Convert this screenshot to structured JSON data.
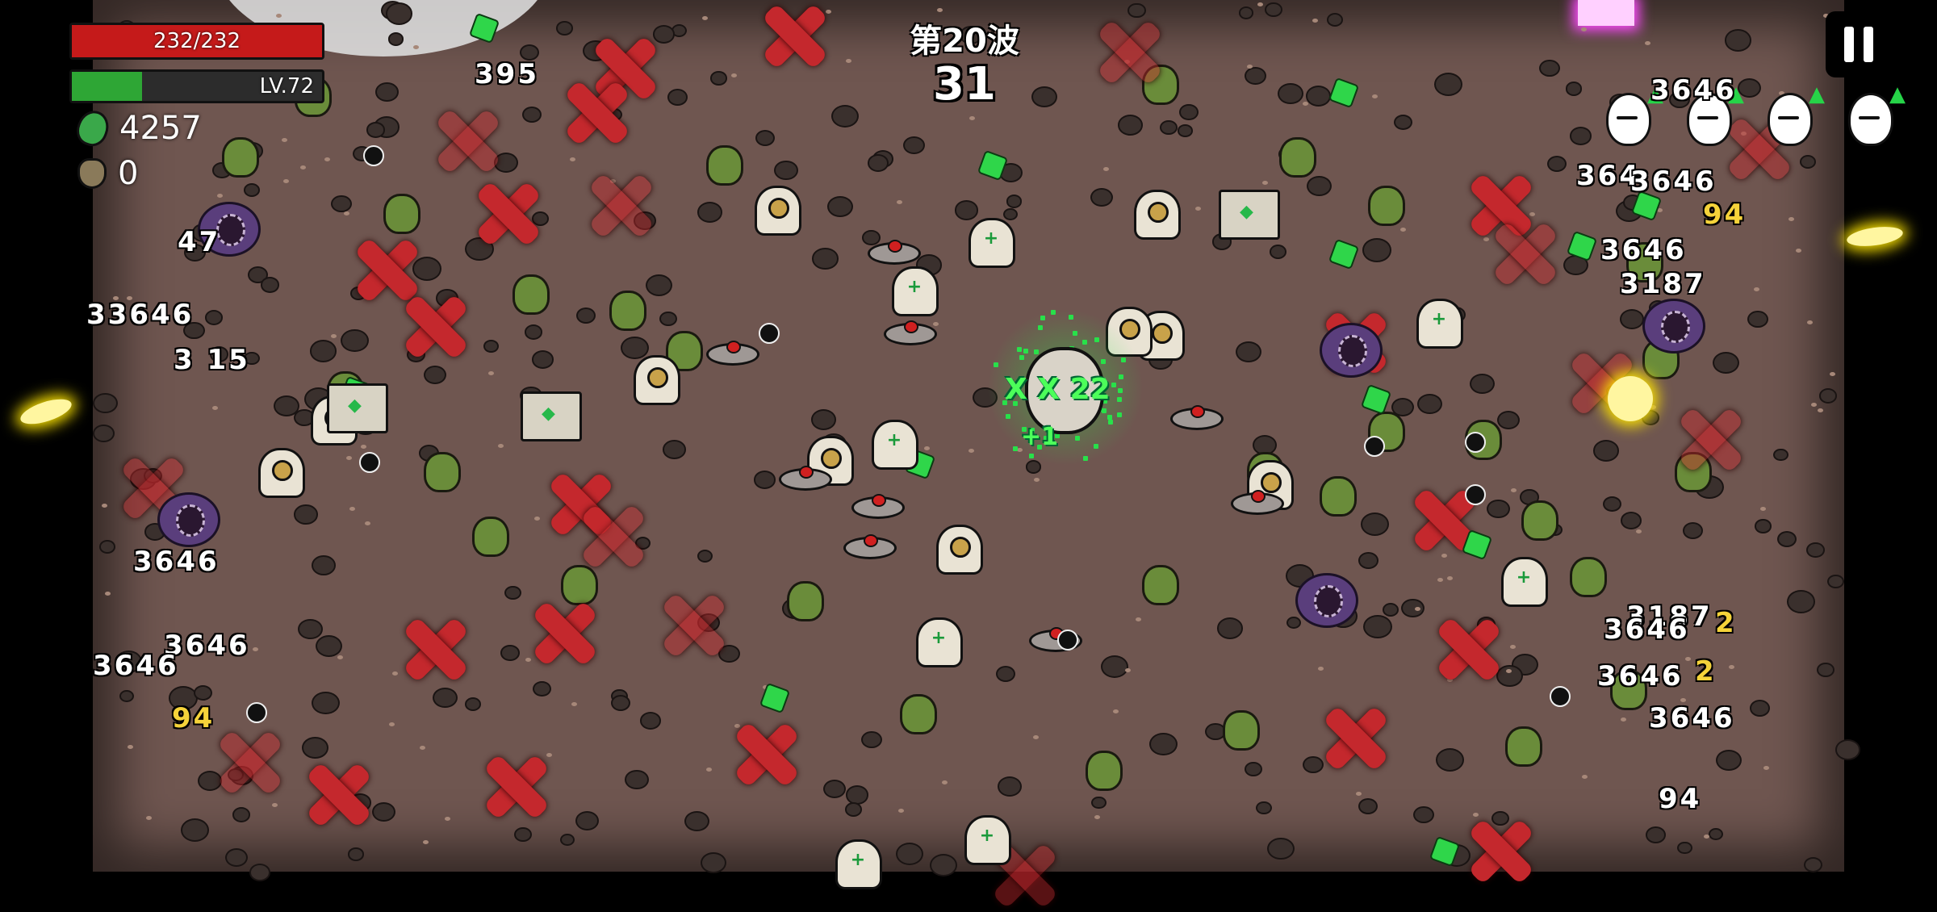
{
  "hud": {
    "hp": {
      "current": 232,
      "max": 232,
      "label": "232/232"
    },
    "level": {
      "label": "LV.72",
      "progress": 0.28
    },
    "materials": {
      "value": "4257",
      "icon": "materials-icon"
    },
    "bag": {
      "value": "0",
      "icon": "bag-icon"
    },
    "wave": {
      "label": "第20波",
      "timer": "31"
    },
    "pause": {
      "icon": "pause-icon"
    }
  },
  "combat": {
    "combo": "X X 22",
    "combo_sub": "+1",
    "damage_numbers": [
      {
        "text": "395",
        "style": "white"
      },
      {
        "text": "47",
        "style": "white"
      },
      {
        "text": "33646",
        "style": "white"
      },
      {
        "text": "3 15",
        "style": "white"
      },
      {
        "text": "3646",
        "style": "white"
      },
      {
        "text": "3646",
        "style": "white"
      },
      {
        "text": "3646",
        "style": "white"
      },
      {
        "text": "94",
        "style": "yellow"
      },
      {
        "text": "3646",
        "style": "white"
      },
      {
        "text": "364",
        "style": "white"
      },
      {
        "text": "3646",
        "style": "white"
      },
      {
        "text": "94",
        "style": "yellow"
      },
      {
        "text": "3646",
        "style": "white"
      },
      {
        "text": "3187",
        "style": "white"
      },
      {
        "text": "3187",
        "style": "white"
      },
      {
        "text": "2",
        "style": "yellow"
      },
      {
        "text": "3646",
        "style": "white"
      },
      {
        "text": "3646",
        "style": "white"
      },
      {
        "text": "2",
        "style": "yellow"
      },
      {
        "text": "3646",
        "style": "white"
      },
      {
        "text": "94",
        "style": "white"
      }
    ]
  },
  "colors": {
    "arena": "#6f5650",
    "hp": "#c51a1a",
    "xp": "#2ea635",
    "material": "#2fd64a",
    "x_mark": "#c4282d"
  }
}
